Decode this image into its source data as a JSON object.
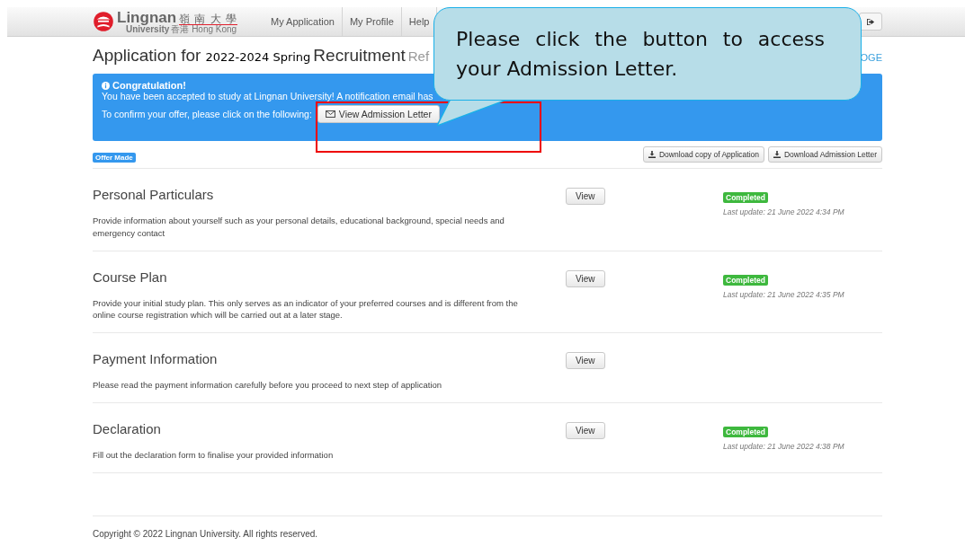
{
  "header": {
    "logo": {
      "name": "Lingnan",
      "chinese": "嶺 南 大 學",
      "sub": "University",
      "place": "香港 Hong Kong"
    },
    "nav": [
      {
        "label": "My Application"
      },
      {
        "label": "My Profile"
      },
      {
        "label": "Help"
      }
    ]
  },
  "page_title": {
    "prefix": "Application for",
    "term": "2022-2024 Spring",
    "suffix": "Recruitment",
    "ref": "Ref",
    "link": "OGE"
  },
  "alert": {
    "heading": "Congratulation!",
    "message": "You have been accepted to study at Lingnan University! A notification email has",
    "prompt": "To confirm your offer, please click on the following:",
    "button": "View Admission Letter"
  },
  "status_label": "Offer Made",
  "downloads": [
    {
      "label": "Download copy of Application"
    },
    {
      "label": "Download Admission Letter"
    }
  ],
  "sections": [
    {
      "title": "Personal Particulars",
      "description": "Provide information about yourself such as your personal details, educational background, special needs and emergency contact",
      "button": "View",
      "status": {
        "label": "Completed",
        "kind": "success"
      },
      "updated": "Last update: 21 June 2022 4:34 PM"
    },
    {
      "title": "Course Plan",
      "description": "Provide your initial study plan. This only serves as an indicator of your preferred courses and is different from the online course registration which will be carried out at a later stage.",
      "button": "View",
      "status": {
        "label": "Completed",
        "kind": "success"
      },
      "updated": "Last update: 21 June 2022 4:35 PM"
    },
    {
      "title": "Payment Information",
      "description": "Please read the payment information carefully before you proceed to next step of application",
      "button": "View"
    },
    {
      "title": "Declaration",
      "description": "Fill out the declaration form to finalise your provided information",
      "button": "View",
      "status": {
        "label": "Completed",
        "kind": "success"
      },
      "updated": "Last update: 21 June 2022 4:38 PM"
    }
  ],
  "footer": "Copyright © 2022 Lingnan University. All rights reserved.",
  "callout": {
    "text": "Please click the button to access your Admission Letter."
  }
}
